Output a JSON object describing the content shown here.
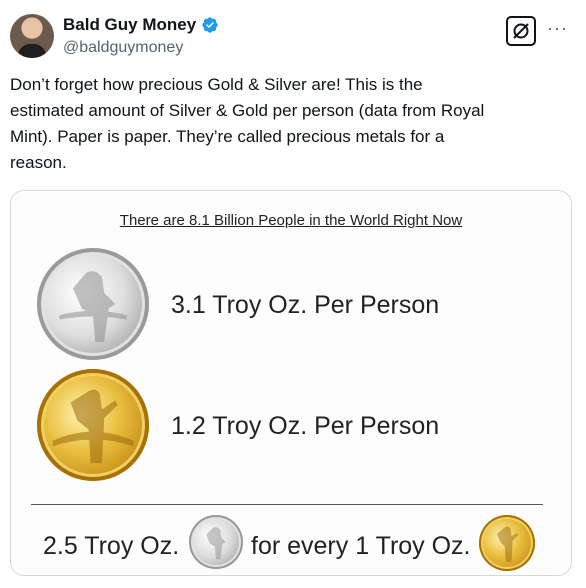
{
  "author": {
    "display_name": "Bald Guy Money",
    "handle": "@baldguymoney"
  },
  "icons": {
    "verified": "verified-badge-icon",
    "grok": "grok-icon",
    "more": "more-icon"
  },
  "colors": {
    "verified_blue": "#1d9bf0",
    "handle_gray": "#536471",
    "text": "#0f1419"
  },
  "tweet": {
    "text": "Don’t forget how precious Gold & Silver are! This is the\nestimated amount of Silver & Gold per person (data from Royal\nMint). Paper is paper. They’re called precious metals for a\nreason."
  },
  "media": {
    "title": "There are 8.1 Billion People in the World Right Now",
    "silver_stat": "3.1 Troy Oz. Per Person",
    "gold_stat": "1.2 Troy Oz. Per Person",
    "ratio_left": "2.5 Troy Oz.",
    "ratio_right": "for every 1 Troy Oz."
  }
}
